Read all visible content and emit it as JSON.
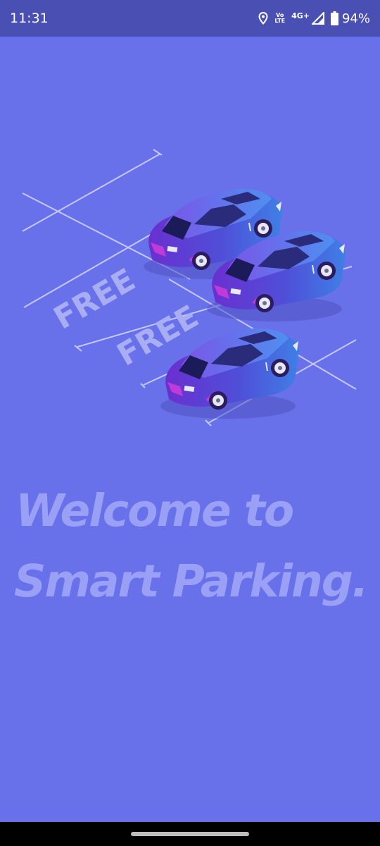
{
  "status_bar": {
    "time": "11:31",
    "volte_top": "Vo",
    "volte_bottom": "LTE",
    "network": "4G+",
    "battery": "94%",
    "icons": [
      "location-icon",
      "signal-icon",
      "battery-icon"
    ]
  },
  "illustration": {
    "spot_labels": [
      "FREE",
      "FREE"
    ],
    "icon": "parking-lot-cars-illustration"
  },
  "welcome": {
    "line1": "Welcome to",
    "line2": "Smart Parking."
  },
  "colors": {
    "background": "#6870ea",
    "status_bar": "#4a4fb3",
    "heading": "#9aa0f5",
    "car_body": "#5b3fd6",
    "parking_lines": "#cfd2ff"
  }
}
